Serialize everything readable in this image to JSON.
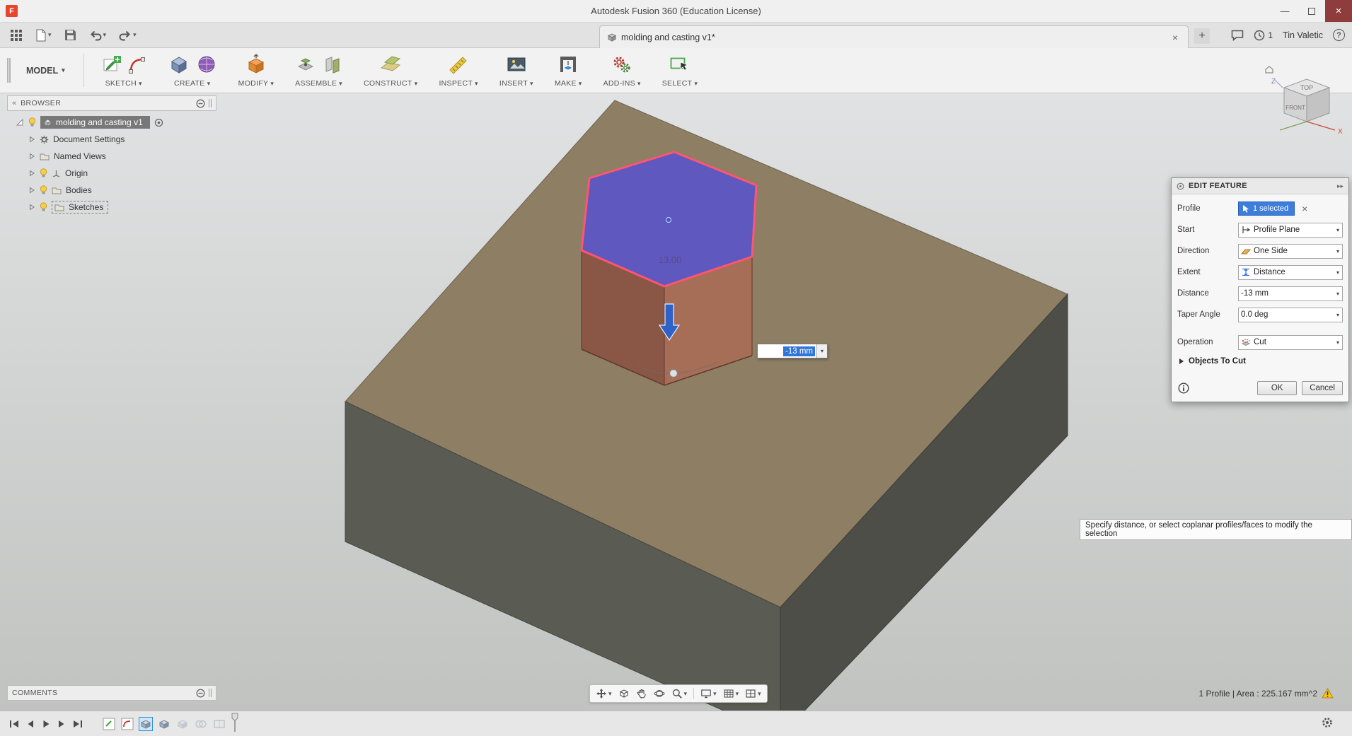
{
  "window": {
    "title": "Autodesk Fusion 360 (Education License)"
  },
  "appbar": {
    "tab_label": "molding and casting v1*",
    "user_name": "Tin Valetic",
    "notification_count": "1"
  },
  "ribbon": {
    "workspace_label": "MODEL",
    "groups": [
      "SKETCH",
      "CREATE",
      "MODIFY",
      "ASSEMBLE",
      "CONSTRUCT",
      "INSPECT",
      "INSERT",
      "MAKE",
      "ADD-INS",
      "SELECT"
    ]
  },
  "browser": {
    "header": "BROWSER",
    "root_label": "molding and casting v1",
    "items": [
      {
        "label": "Document Settings"
      },
      {
        "label": "Named Views"
      },
      {
        "label": "Origin"
      },
      {
        "label": "Bodies"
      },
      {
        "label": "Sketches"
      }
    ]
  },
  "viewcube": {
    "top": "TOP",
    "front": "FRONT",
    "z": "Z",
    "x": "X"
  },
  "scene": {
    "dim_label": "13.00",
    "distance_value": "-13 mm"
  },
  "dialog": {
    "title": "EDIT FEATURE",
    "profile_label": "Profile",
    "profile_value": "1 selected",
    "start_label": "Start",
    "start_value": "Profile Plane",
    "direction_label": "Direction",
    "direction_value": "One Side",
    "extent_label": "Extent",
    "extent_value": "Distance",
    "distance_label": "Distance",
    "distance_value": "-13 mm",
    "taper_label": "Taper Angle",
    "taper_value": "0.0 deg",
    "operation_label": "Operation",
    "operation_value": "Cut",
    "objects_label": "Objects To Cut",
    "ok": "OK",
    "cancel": "Cancel"
  },
  "hint": {
    "text": "Specify distance, or select coplanar profiles/faces to modify the selection"
  },
  "comments": {
    "header": "COMMENTS"
  },
  "statusbar": {
    "selection_info": "1 Profile | Area : 225.167 mm^2"
  },
  "colors": {
    "accent_blue": "#3d7edb",
    "selection_face_blue": "#5656cd",
    "highlight_pink": "#ff5570",
    "model_top": "#8d7e64",
    "close_button": "#8f3c3c"
  }
}
